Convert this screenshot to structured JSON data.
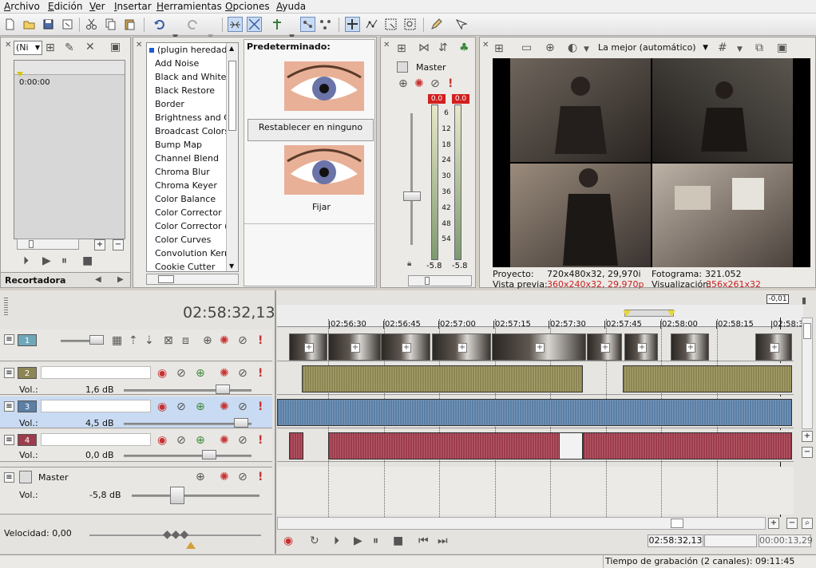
{
  "menu": [
    "Archivo",
    "Edición",
    "Ver",
    "Insertar",
    "Herramientas",
    "Opciones",
    "Ayuda"
  ],
  "trimmer": {
    "dropdown": "(Ni",
    "timecode": "0:00:00",
    "tab": "Recortadora"
  },
  "effects": {
    "items": [
      "(plugin heredado)",
      "Add Noise",
      "Black and White",
      "Black Restore",
      "Border",
      "Brightness and Co",
      "Broadcast Colors",
      "Bump Map",
      "Channel Blend",
      "Chroma Blur",
      "Chroma Keyer",
      "Color Balance",
      "Color Corrector",
      "Color Corrector (S",
      "Color Curves",
      "Convolution Kerne",
      "Cookie Cutter"
    ],
    "preset_title": "Predeterminado:",
    "reset_label": "Restablecer en ninguno",
    "fix_label": "Fijar"
  },
  "mixer": {
    "title": "Master",
    "peak_left": "0.0",
    "peak_right": "0.0",
    "scale": [
      "6",
      "12",
      "18",
      "24",
      "30",
      "36",
      "42",
      "48",
      "54"
    ],
    "level_left": "-5.8",
    "level_right": "-5.8"
  },
  "preview": {
    "quality": "La mejor (automático)",
    "project_label": "Proyecto:",
    "project_value": "720x480x32, 29,970i",
    "preview_label": "Vista previa:",
    "preview_value": "360x240x32, 29,970p",
    "frame_label": "Fotograma:",
    "frame_value": "321.052",
    "display_label": "Visualización:",
    "display_value": "356x261x32",
    "accent_red": "#c81e1e"
  },
  "timeline": {
    "current_time": "02:58:32,13",
    "marker_value": "-0,01",
    "ruler": [
      "02:56:30",
      "02:56:45",
      "02:57:00",
      "02:57:15",
      "02:57:30",
      "02:57:45",
      "02:58:00",
      "02:58:15",
      "02:58:3"
    ],
    "tracks": [
      {
        "number": "1",
        "color": "#6fa7b8"
      },
      {
        "number": "2",
        "color": "#8c8654",
        "vol_label": "Vol.:",
        "vol_value": "1,6 dB"
      },
      {
        "number": "3",
        "color": "#5b7fa5",
        "vol_label": "Vol.:",
        "vol_value": "4,5 dB"
      },
      {
        "number": "4",
        "color": "#9c3c4c",
        "vol_label": "Vol.:",
        "vol_value": "0,0 dB"
      }
    ],
    "master": {
      "label": "Master",
      "vol_label": "Vol.:",
      "vol_value": "-5,8 dB"
    },
    "speed": "Velocidad: 0,00",
    "transport_time": "02:58:32,13",
    "transport_time2": "00:00:13,29",
    "status": "Tiempo de grabación (2 canales): 09:11:45"
  }
}
